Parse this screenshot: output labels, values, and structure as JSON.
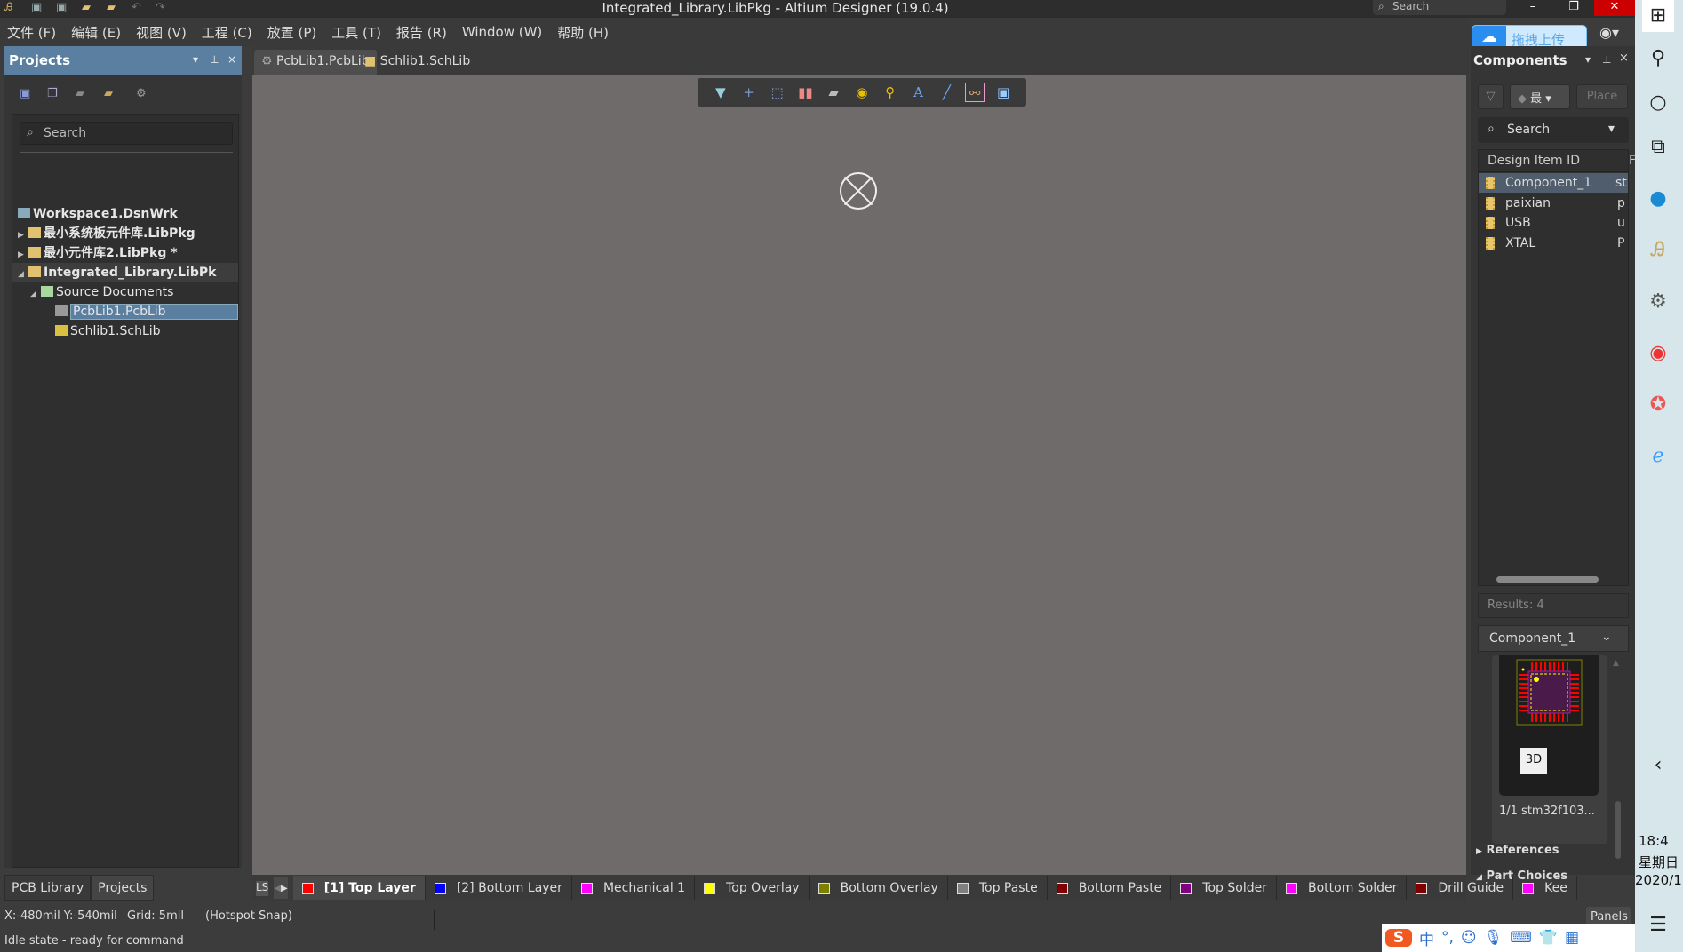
{
  "window": {
    "title": "Integrated_Library.LibPkg - Altium Designer (19.0.4)",
    "search_placeholder": "Search",
    "minimize": "–",
    "restore": "❐",
    "close": "✕"
  },
  "menu": [
    "文件 (F)",
    "编辑 (E)",
    "视图 (V)",
    "工程 (C)",
    "放置 (P)",
    "工具 (T)",
    "报告 (R)",
    "Window (W)",
    "帮助 (H)"
  ],
  "baidu": {
    "label": "拖拽上传"
  },
  "projects": {
    "title": "Projects",
    "search_placeholder": "Search",
    "tree": [
      {
        "label": "Workspace1.DsnWrk",
        "bold": true
      },
      {
        "label": "最小系统板元件库.LibPkg",
        "bold": true
      },
      {
        "label": "最小元件库2.LibPkg *",
        "bold": true
      },
      {
        "label": "Integrated_Library.LibPk",
        "bold": true
      },
      {
        "label": "Source Documents"
      },
      {
        "label": "PcbLib1.PcbLib",
        "selected": true
      },
      {
        "label": "Schlib1.SchLib"
      }
    ]
  },
  "doc_tabs": [
    "PcbLib1.PcbLib",
    "Schlib1.SchLib"
  ],
  "toolbar": [
    "filter-icon",
    "cross-icon",
    "select-rect-icon",
    "align-icon",
    "component-icon",
    "pad-icon",
    "via-icon",
    "text-icon",
    "line-icon",
    "route-icon",
    "dimension-icon"
  ],
  "components": {
    "title": "Components",
    "library_selector": "最",
    "place_label": "Place",
    "search_placeholder": "Search",
    "columns": [
      "Design Item ID",
      "F"
    ],
    "rows": [
      {
        "id": "Component_1",
        "extra": "st"
      },
      {
        "id": "paixian",
        "extra": "p"
      },
      {
        "id": "USB",
        "extra": "u"
      },
      {
        "id": "XTAL",
        "extra": "P"
      }
    ],
    "results": "Results: 4",
    "detail_title": "Component_1",
    "btn_3d": "3D",
    "model": "1/1  stm32f103...",
    "references": "References",
    "part_choices": "Part Choices"
  },
  "bottom_tabs": [
    "PCB Library",
    "Projects"
  ],
  "layer_set": "LS",
  "layers": [
    {
      "name": "[1] Top Layer",
      "color": "#ff0000",
      "active": true
    },
    {
      "name": "[2] Bottom Layer",
      "color": "#0000ff"
    },
    {
      "name": "Mechanical 1",
      "color": "#ff00ff"
    },
    {
      "name": "Top Overlay",
      "color": "#ffff00"
    },
    {
      "name": "Bottom Overlay",
      "color": "#808000"
    },
    {
      "name": "Top Paste",
      "color": "#808080"
    },
    {
      "name": "Bottom Paste",
      "color": "#800000"
    },
    {
      "name": "Top Solder",
      "color": "#800080"
    },
    {
      "name": "Bottom Solder",
      "color": "#ff00ff"
    },
    {
      "name": "Drill Guide",
      "color": "#800000"
    },
    {
      "name": "Kee",
      "color": "#ff00ff"
    }
  ],
  "status": {
    "coords": "X:-480mil Y:-540mil",
    "grid": "Grid: 5mil",
    "snap": "(Hotspot Snap)",
    "state": "Idle state - ready for command",
    "panels": "Panels"
  },
  "taskbar": {
    "time": "18:4",
    "day": "星期日",
    "date": "2020/1",
    "ime": "中"
  }
}
